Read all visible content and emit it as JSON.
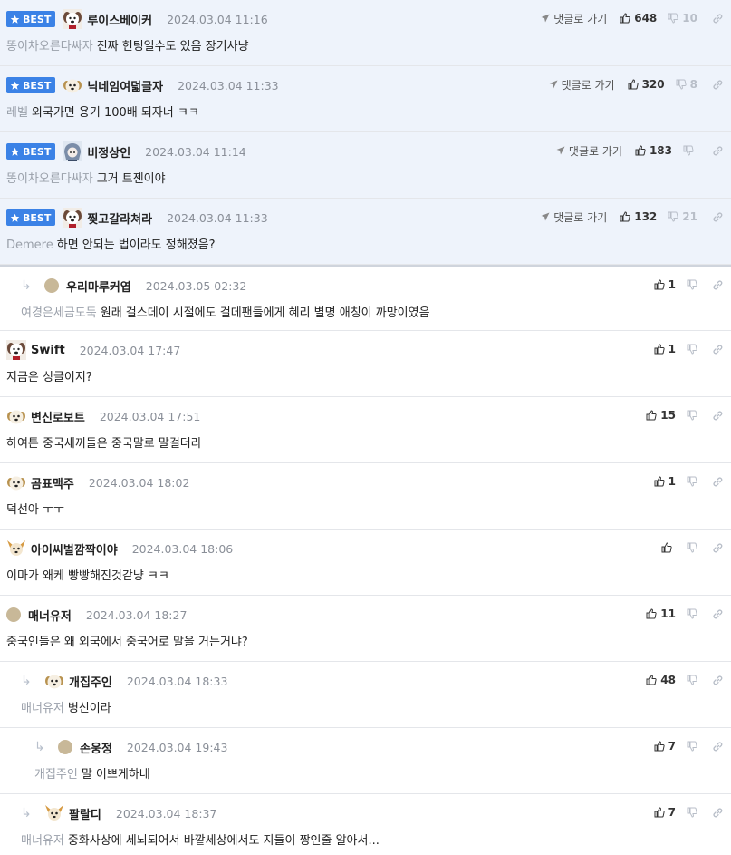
{
  "labels": {
    "best": "BEST",
    "goto_comment": "댓글로 가기"
  },
  "colors": {
    "best_bg": "#eef3fb",
    "badge": "#3b82e6",
    "muted": "#8a8f98"
  },
  "comments": [
    {
      "type": "best",
      "nick": "루이스베이커",
      "date": "2024.03.04 11:16",
      "prefix": "똥이차오른다싸자",
      "text": "진짜 헌팅일수도 있음 장기사냥",
      "up": "648",
      "down": "10",
      "avatar": "dog-avatar-icon"
    },
    {
      "type": "best",
      "nick": "닉네임여덟글자",
      "date": "2024.03.04 11:33",
      "prefix": "레벨",
      "text": "외국가면 용기 100배 되자너 ㅋㅋ",
      "up": "320",
      "down": "8",
      "avatar": "puppy-avatar-icon"
    },
    {
      "type": "best",
      "nick": "비정상인",
      "date": "2024.03.04 11:14",
      "prefix": "똥이차오른다싸자",
      "text": "그거 트젠이야",
      "up": "183",
      "down": "",
      "avatar": "anime-avatar-icon"
    },
    {
      "type": "best",
      "nick": "찢고갈라쳐라",
      "date": "2024.03.04 11:33",
      "prefix": "Demere",
      "text": "하면 안되는 법이라도 정해졌음?",
      "up": "132",
      "down": "21",
      "avatar": "dog-avatar-icon"
    },
    {
      "type": "reply",
      "indent": 1,
      "nick": "우리마루커엽",
      "date": "2024.03.05 02:32",
      "prefix": "여경은세금도둑",
      "text": "원래 걸스데이 시절에도 걸데팬들에게 혜리 별명 애칭이 까망이였음",
      "up": "1",
      "avatar": "dot"
    },
    {
      "type": "normal",
      "indent": 0,
      "nick": "Swift",
      "date": "2024.03.04 17:47",
      "prefix": "",
      "text": "지금은 싱글이지?",
      "up": "1",
      "avatar": "dog-avatar-icon"
    },
    {
      "type": "normal",
      "indent": 0,
      "nick": "변신로보트",
      "date": "2024.03.04 17:51",
      "prefix": "",
      "text": "하여튼 중국새끼들은 중국말로 말걸더라",
      "up": "15",
      "avatar": "puppy-avatar-icon"
    },
    {
      "type": "normal",
      "indent": 0,
      "nick": "곰표맥주",
      "date": "2024.03.04 18:02",
      "prefix": "",
      "text": "덕선아 ㅜㅜ",
      "up": "1",
      "avatar": "puppy-avatar-icon"
    },
    {
      "type": "normal",
      "indent": 0,
      "nick": "아이씨벌깜짝이야",
      "date": "2024.03.04 18:06",
      "prefix": "",
      "text": "이마가 왜케 빵빵해진것같냥 ㅋㅋ",
      "up": "",
      "avatar": "chihuahua-avatar-icon"
    },
    {
      "type": "normal",
      "indent": 0,
      "nick": "매너유저",
      "date": "2024.03.04 18:27",
      "prefix": "",
      "text": "중국인들은 왜 외국에서 중국어로 말을 거는거냐?",
      "up": "11",
      "avatar": "dot"
    },
    {
      "type": "reply",
      "indent": 1,
      "nick": "개집주인",
      "date": "2024.03.04 18:33",
      "prefix": "매너유저",
      "text": "병신이라",
      "up": "48",
      "avatar": "puppy-avatar-icon"
    },
    {
      "type": "reply",
      "indent": 2,
      "nick": "손웅정",
      "date": "2024.03.04 19:43",
      "prefix": "개집주인",
      "text": "말 이쁘게하네",
      "up": "7",
      "avatar": "dot"
    },
    {
      "type": "reply",
      "indent": 1,
      "nick": "팔랄디",
      "date": "2024.03.04 18:37",
      "prefix": "매너유저",
      "text": "중화사상에 세뇌되어서 바깥세상에서도 지들이 짱인줄 알아서...",
      "up": "7",
      "avatar": "chihuahua-avatar-icon"
    }
  ]
}
